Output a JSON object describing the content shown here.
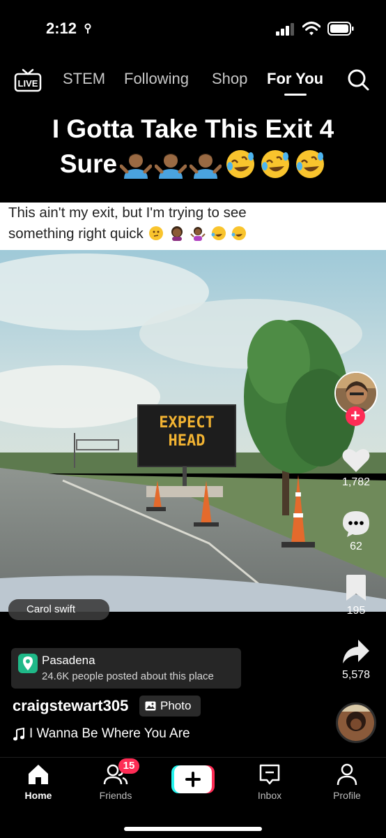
{
  "status_bar": {
    "time": "2:12"
  },
  "top_nav": {
    "live_label": "LIVE",
    "tabs": [
      {
        "label": "STEM",
        "active": false
      },
      {
        "label": "Following",
        "active": false
      },
      {
        "label": "Shop",
        "active": false
      },
      {
        "label": "For You",
        "active": true
      }
    ]
  },
  "caption": {
    "line1": "I Gotta Take This Exit 4",
    "line2": "Sure",
    "emojis": [
      "person-shrugging",
      "person-shrugging",
      "person-shrugging",
      "rolling-on-floor-laughing",
      "rolling-on-floor-laughing",
      "rolling-on-floor-laughing"
    ]
  },
  "meme": {
    "line1": "This ain't my exit, but I'm trying to see",
    "line2": "something right quick",
    "sign_line1": "EXPECT",
    "sign_line2": "HEAD"
  },
  "sound_chip": {
    "label": "Carol swift"
  },
  "actions": {
    "likes": "1,782",
    "comments": "62",
    "saves": "195",
    "shares": "5,578"
  },
  "location": {
    "name": "Pasadena",
    "subtitle": "24.6K people posted about this place"
  },
  "post": {
    "username": "craigstewart305",
    "type_badge": "Photo",
    "song": "I Wanna Be Where You Are"
  },
  "bottom_nav": {
    "items": [
      {
        "label": "Home",
        "active": true
      },
      {
        "label": "Friends",
        "active": false
      },
      {
        "label": "Inbox",
        "active": false
      },
      {
        "label": "Profile",
        "active": false
      }
    ],
    "friends_badge": "15"
  },
  "colors": {
    "accent": "#fe2c55",
    "cyan": "#25f4ee",
    "location_green": "#1fb988"
  }
}
